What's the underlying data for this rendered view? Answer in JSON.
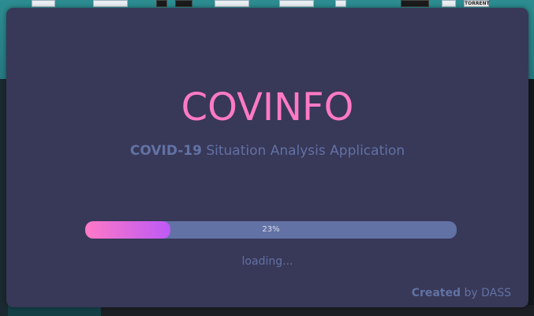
{
  "splash": {
    "title": "COVINFO",
    "subtitle_bold": "COVID-19",
    "subtitle_rest": " Situation Analysis Application",
    "progress": {
      "value": 23,
      "label": "23%"
    },
    "status_text": "loading...",
    "credit_bold": "Created",
    "credit_rest": " by DASS"
  },
  "desktop": {
    "torrent_label": "TORRENT"
  },
  "colors": {
    "window_bg": "#383858",
    "title": "#ff79c6",
    "muted": "#6272a4",
    "progress_start": "#ff79c6",
    "progress_end": "#bd59f6"
  }
}
